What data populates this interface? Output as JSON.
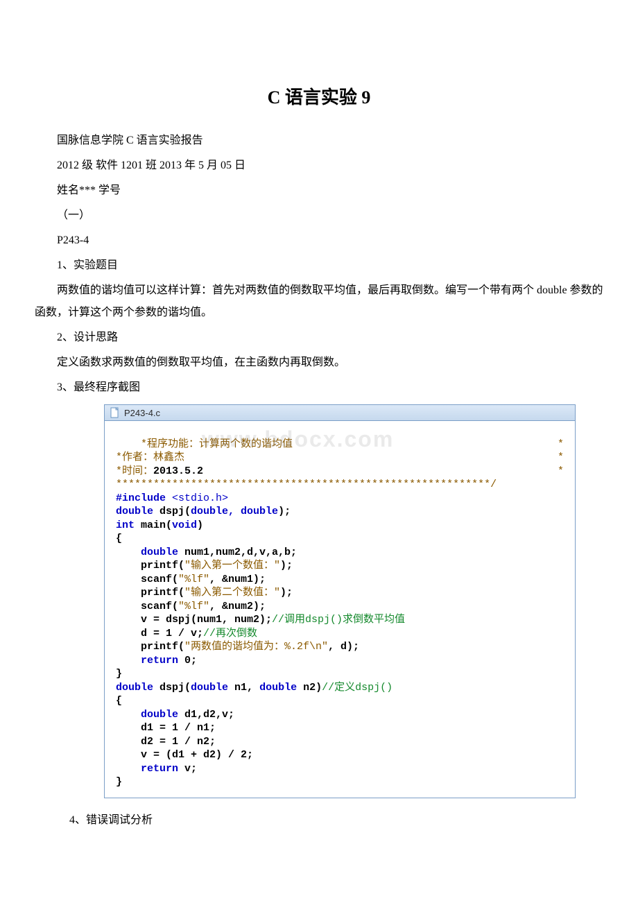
{
  "title": "C 语言实验 9",
  "lines": {
    "l1": "国脉信息学院 C 语言实验报告",
    "l2": "2012 级 软件 1201 班 2013 年 5 月 05 日",
    "l3": "姓名*** 学号",
    "l4": "（一）",
    "l5": "P243-4",
    "l6": "1、实验题目",
    "l7": "两数值的谐均值可以这样计算：首先对两数值的倒数取平均值，最后再取倒数。编写一个带有两个 double 参数的函数，计算这个两个参数的谐均值。",
    "l8": "2、设计思路",
    "l9": "定义函数求两数值的倒数取平均值，在主函数内再取倒数。",
    "l10": "3、最终程序截图",
    "l11": "4、错误调试分析"
  },
  "code": {
    "filename": "P243-4.c",
    "watermark": "www.bdocx.com",
    "header_line1_a": "*程序功能：",
    "header_line1_b": "计算两个数的谐均值",
    "header_line1_end": "*",
    "header_line2": "*作者：林鑫杰",
    "header_line2_end": "*",
    "header_line3": "*时间：",
    "header_line3_date": "2013.5.2",
    "header_line3_end": "*",
    "header_divider": "************************************************************/",
    "inc_directive": "#include",
    "inc_header": "<stdio.h>",
    "proto_ret": "double",
    "proto_name": " dspj(",
    "proto_args": "double, double",
    "proto_end": ");",
    "main_ret": "int",
    "main_sig": " main(",
    "main_void": "void",
    "main_sig_end": ")",
    "brace_open": "{",
    "decl1_kw": "    double",
    "decl1_vars": " num1,num2,d,v,a,b;",
    "p1a": "    printf(",
    "p1b": "\"输入第一个数值：\"",
    "p1c": ");",
    "s1a": "    scanf(",
    "s1b": "\"%lf\"",
    "s1c": ", &num1);",
    "p2a": "    printf(",
    "p2b": "\"输入第二个数值：\"",
    "p2c": ");",
    "s2a": "    scanf(",
    "s2b": "\"%lf\"",
    "s2c": ", &num2);",
    "call1": "    v = dspj(num1, num2);",
    "call1_cmt": "//调用dspj()求倒数平均值",
    "calc1": "    d = 1 / v;",
    "calc1_cmt": "//再次倒数",
    "p3a": "    printf(",
    "p3b": "\"两数值的谐均值为：%.2f\\n\"",
    "p3c": ", d);",
    "ret0_kw": "    return",
    "ret0_val": " 0;",
    "brace_close": "}",
    "fn2_ret": "double",
    "fn2_sig": " dspj(",
    "fn2_arg1t": "double",
    "fn2_arg1n": " n1, ",
    "fn2_arg2t": "double",
    "fn2_arg2n": " n2)",
    "fn2_cmt": "//定义dspj()",
    "decl2_kw": "    double",
    "decl2_vars": " d1,d2,v;",
    "asg1": "    d1 = 1 / n1;",
    "asg2": "    d2 = 1 / n2;",
    "asg3": "    v = (d1 + d2) / 2;",
    "retv_kw": "    return",
    "retv_val": " v;"
  }
}
